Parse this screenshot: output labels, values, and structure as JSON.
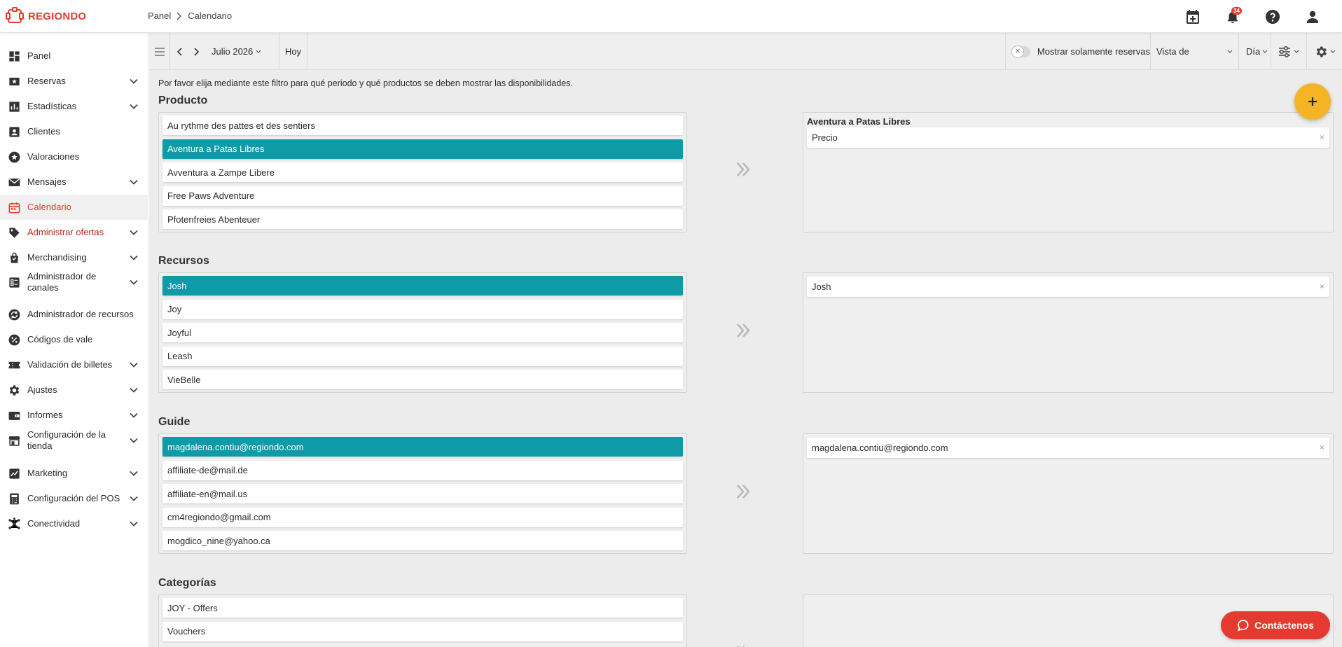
{
  "app": {
    "logo_text": "REGIONDO"
  },
  "breadcrumb": {
    "root": "Panel",
    "current": "Calendario"
  },
  "header": {
    "notification_count": "34"
  },
  "sidebar": {
    "items": [
      {
        "label": "Panel",
        "icon": "dashboard-icon",
        "expandable": false
      },
      {
        "label": "Reservas",
        "icon": "bookings-star-icon",
        "expandable": true
      },
      {
        "label": "Estadísticas",
        "icon": "bar-chart-icon",
        "expandable": true
      },
      {
        "label": "Clientes",
        "icon": "person-card-icon",
        "expandable": false
      },
      {
        "label": "Valoraciones",
        "icon": "star-circle-icon",
        "expandable": false
      },
      {
        "label": "Mensajes",
        "icon": "mail-icon",
        "expandable": true
      },
      {
        "label": "Calendario",
        "icon": "calendar-icon",
        "expandable": false,
        "active": true
      },
      {
        "label": "Administrar ofertas",
        "icon": "tag-icon",
        "expandable": true
      },
      {
        "label": "Merchandising",
        "icon": "shopping-bag-icon",
        "expandable": true
      },
      {
        "label": "Administrador de canales",
        "icon": "channels-icon",
        "expandable": true
      },
      {
        "label": "Administrador de recursos",
        "icon": "resources-icon",
        "expandable": false
      },
      {
        "label": "Códigos de vale",
        "icon": "percent-icon",
        "expandable": false
      },
      {
        "label": "Validación de billetes",
        "icon": "ticket-icon",
        "expandable": true
      },
      {
        "label": "Ajustes",
        "icon": "gear-icon",
        "expandable": true
      },
      {
        "label": "Informes",
        "icon": "wallet-icon",
        "expandable": true
      },
      {
        "label": "Configuración de la tienda",
        "icon": "store-icon",
        "expandable": true
      },
      {
        "label": "Marketing",
        "icon": "marketing-icon",
        "expandable": true
      },
      {
        "label": "Configuración del POS",
        "icon": "calculator-icon",
        "expandable": true
      },
      {
        "label": "Conectividad",
        "icon": "network-icon",
        "expandable": true
      }
    ]
  },
  "toolbar": {
    "month": "Julio 2026",
    "today": "Hoy",
    "only_bookings_label": "Mostrar solamente reservas",
    "view_label": "Vista de",
    "day_label": "Día"
  },
  "intro_text": "Por favor elija mediante este filtro para qué periodo y qué productos se deben mostrar las disponibilidades.",
  "sections": {
    "producto": {
      "title": "Producto",
      "items": [
        "Au rythme des pattes et des sentiers",
        "Aventura a Patas Libres",
        "Avventura a Zampe Libere",
        "Free Paws Adventure",
        "Pfotenfreies Abenteuer"
      ],
      "selected_header": "Aventura a Patas Libres",
      "selected_items": [
        "Precio"
      ]
    },
    "recursos": {
      "title": "Recursos",
      "items": [
        "Josh",
        "Joy",
        "Joyful",
        "Leash",
        "VieBelle"
      ],
      "selected_items": [
        "Josh"
      ]
    },
    "guide": {
      "title": "Guide",
      "items": [
        "magdalena.contiu@regiondo.com",
        "affiliate-de@mail.de",
        "affiliate-en@mail.us",
        "cm4regiondo@gmail.com",
        "mogdico_nine@yahoo.ca"
      ],
      "selected_items": [
        "magdalena.contiu@regiondo.com"
      ]
    },
    "categorias": {
      "title": "Categorías",
      "items": [
        "JOY - Offers",
        "Vouchers"
      ]
    }
  },
  "contact_button": "Contáctenos",
  "colors": {
    "brand": "#e53a2f",
    "selected": "#0e9aa7",
    "fab": "#f5b425"
  }
}
